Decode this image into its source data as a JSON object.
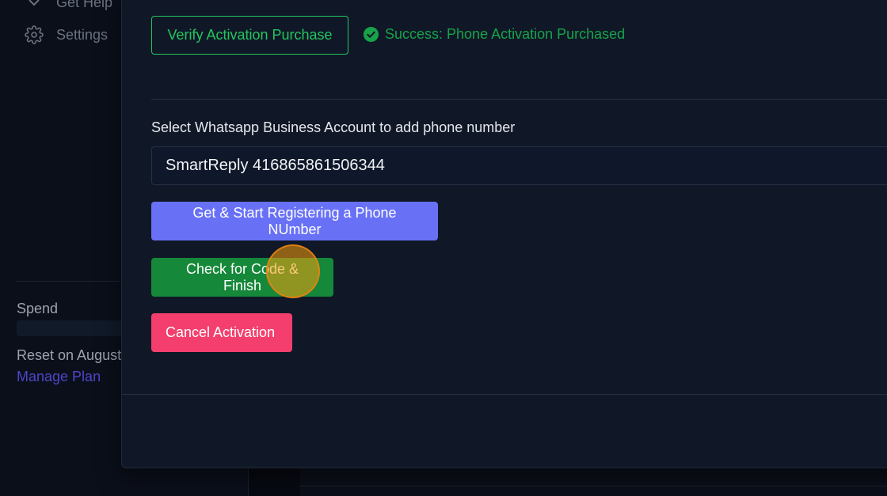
{
  "sidebar": {
    "items": [
      {
        "label": "Get Help",
        "icon": "chevron-down-icon"
      },
      {
        "label": "Settings",
        "icon": "gear-icon"
      }
    ],
    "spend_label": "Spend",
    "reset_text": "Reset on August",
    "manage_plan": "Manage Plan"
  },
  "modal": {
    "verify_button": "Verify Activation Purchase",
    "success_message": "Success: Phone Activation Purchased",
    "select_label": "Select Whatsapp Business Account to add phone number",
    "selected_account": "SmartReply 416865861506344",
    "register_button": "Get & Start Registering a Phone NUmber",
    "check_button": "Check for Code & Finish",
    "cancel_button": "Cancel Activation"
  },
  "colors": {
    "success": "#22c55e",
    "primary": "#6871f6",
    "check": "#16883a",
    "cancel": "#f43f6e",
    "link": "#4f46c8"
  }
}
